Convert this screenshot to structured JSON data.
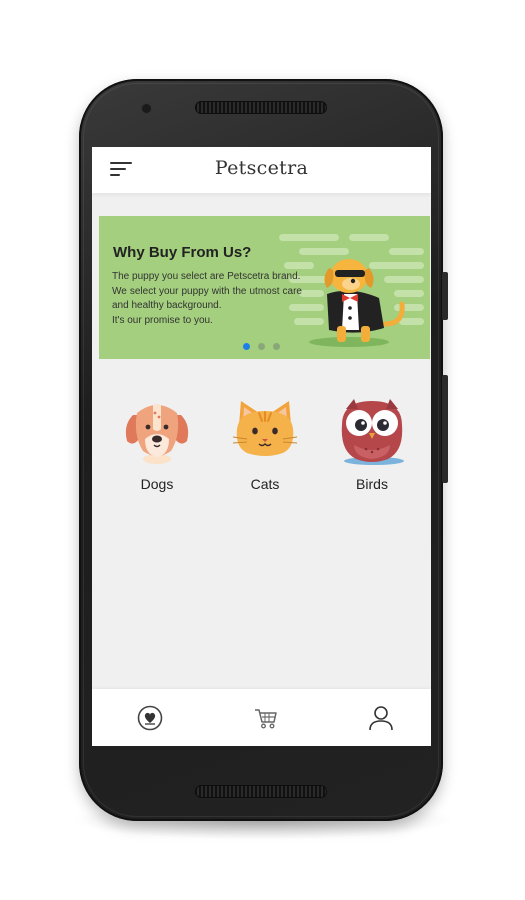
{
  "app": {
    "title": "Petscetra"
  },
  "banner": {
    "heading": "Why Buy From Us?",
    "lines": [
      "The puppy you select are Petscetra brand.",
      "We select your puppy with the utmost care and healthy background.",
      "It's our promise to you."
    ],
    "carousel": {
      "total": 3,
      "active": 0
    },
    "colors": {
      "background": "#a3cf7e",
      "active_dot": "#1e7fe8"
    }
  },
  "categories": [
    {
      "label": "Dogs",
      "icon": "dog-face-icon"
    },
    {
      "label": "Cats",
      "icon": "cat-face-icon"
    },
    {
      "label": "Birds",
      "icon": "owl-icon"
    }
  ],
  "bottom_nav": [
    {
      "icon": "heart-badge-icon",
      "name": "favorites"
    },
    {
      "icon": "cart-icon",
      "name": "cart"
    },
    {
      "icon": "profile-icon",
      "name": "profile"
    }
  ]
}
